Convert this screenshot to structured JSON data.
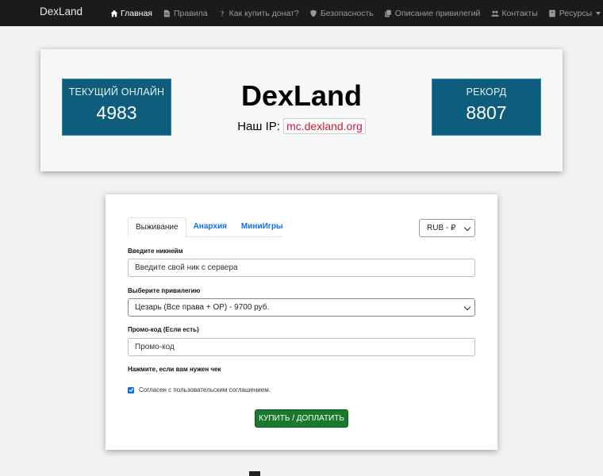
{
  "navbar": {
    "brand": "DexLand",
    "items": [
      {
        "label": "Главная",
        "icon": "home-icon",
        "active": true
      },
      {
        "label": "Правила",
        "icon": "file-icon",
        "active": false
      },
      {
        "label": "Как купить донат?",
        "icon": "question-icon",
        "active": false
      },
      {
        "label": "Безопасность",
        "icon": "shield-icon",
        "active": false
      },
      {
        "label": "Описание привилегий",
        "icon": "copy-icon",
        "active": false
      },
      {
        "label": "Контакты",
        "icon": "users-icon",
        "active": false
      },
      {
        "label": "Ресурсы",
        "icon": "archive-icon",
        "active": false,
        "dropdown": true
      }
    ]
  },
  "hero": {
    "title": "DexLand",
    "ip_label": "Наш IP:",
    "ip_value": "mc.dexland.org",
    "online": {
      "label": "ТЕКУЩИЙ ОНЛАЙН",
      "value": "4983"
    },
    "record": {
      "label": "РЕКОРД",
      "value": "8807"
    }
  },
  "form": {
    "tabs": [
      {
        "label": "Выживание",
        "active": true
      },
      {
        "label": "Анархия",
        "active": false
      },
      {
        "label": "МиниИгры",
        "active": false
      }
    ],
    "currency": "RUB - ₽",
    "nickname_label": "Введите никнейм",
    "nickname_placeholder": "Введите свой ник с сервера",
    "privilege_label": "Выберите привилегию",
    "privilege_selected": "Цезарь (Все права + OP) - 9700 руб.",
    "promo_label": "Промо-код (Если есть)",
    "promo_placeholder": "Промо-код",
    "receipt_label": "Нажмите, если вам нужен чек",
    "agreement_label": "Согласен с пользовательским соглашением.",
    "agreement_checked": true,
    "buy_label": "КУПИТЬ / ДОПЛАТИТЬ"
  },
  "colors": {
    "navbar_bg": "#1b1b1b",
    "stat_bg": "#0f5d7d",
    "ip_color": "#cc1c3a",
    "buy_bg": "#197a2d",
    "link": "#0d6efd"
  }
}
